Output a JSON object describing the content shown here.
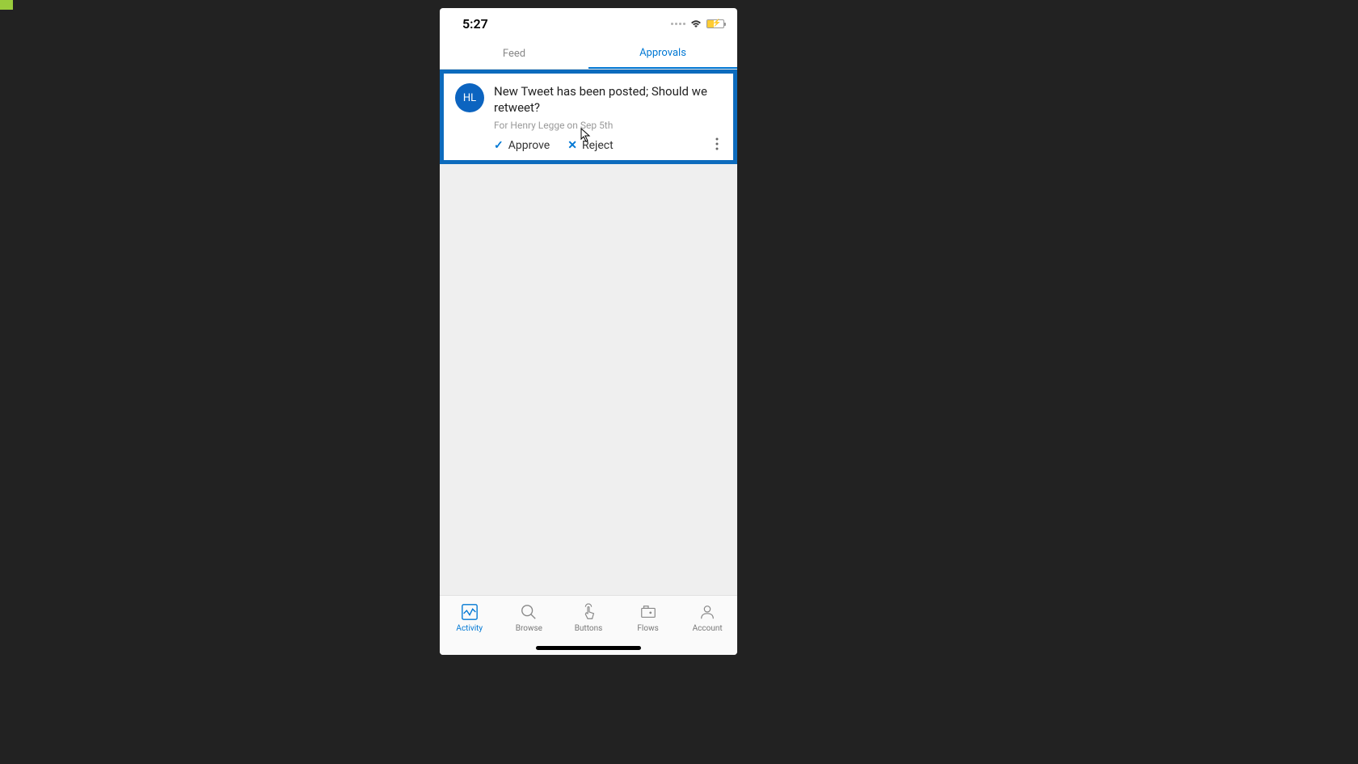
{
  "status_bar": {
    "time": "5:27"
  },
  "tabs": [
    {
      "label": "Feed",
      "active": false
    },
    {
      "label": "Approvals",
      "active": true
    }
  ],
  "approval": {
    "avatar_initials": "HL",
    "title": "New Tweet has been posted; Should we retweet?",
    "meta": "For Henry Legge on Sep 5th",
    "approve_label": "Approve",
    "reject_label": "Reject"
  },
  "bottom_nav": [
    {
      "label": "Activity",
      "active": true
    },
    {
      "label": "Browse",
      "active": false
    },
    {
      "label": "Buttons",
      "active": false
    },
    {
      "label": "Flows",
      "active": false
    },
    {
      "label": "Account",
      "active": false
    }
  ]
}
